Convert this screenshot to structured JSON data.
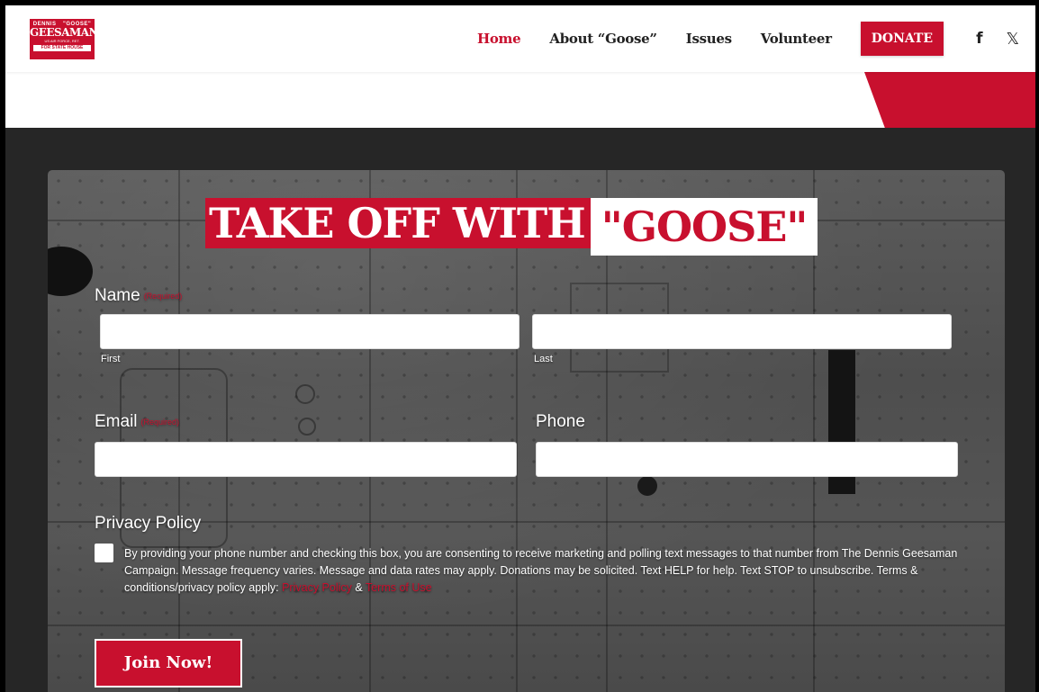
{
  "logo": {
    "line1a": "DENNIS",
    "line1b": "\"GOOSE\"",
    "name": "GEESAMAN",
    "tagline": "US AIR FORCE, RET.",
    "office": "FOR STATE HOUSE"
  },
  "nav": {
    "items": [
      {
        "label": "Home",
        "active": true
      },
      {
        "label": "About “Goose”",
        "active": false
      },
      {
        "label": "Issues",
        "active": false
      },
      {
        "label": "Volunteer",
        "active": false
      }
    ],
    "donate_label": "DONATE",
    "facebook_glyph": "f",
    "x_glyph": "𝕏"
  },
  "colors": {
    "brand_red": "#c8102e",
    "dark_bg": "#262626"
  },
  "headline": {
    "part1": "TAKE OFF WITH",
    "part2": "\"GOOSE\""
  },
  "form": {
    "name_label": "Name",
    "required_text": "(Required)",
    "first_sublabel": "First",
    "last_sublabel": "Last",
    "first_value": "",
    "last_value": "",
    "email_label": "Email",
    "email_value": "",
    "phone_label": "Phone",
    "phone_value": "",
    "privacy_label": "Privacy Policy",
    "privacy_checked": false,
    "consent_text": "By providing your phone number and checking this box, you are consenting to receive marketing and polling text messages to that number from The Dennis Geesaman Campaign. Message frequency varies. Message and data rates may apply. Donations may be solicited. Text HELP for help. Text STOP to unsubscribe. Terms & conditions/privacy policy apply: ",
    "privacy_link": "Privacy Policy",
    "amp": " & ",
    "terms_link": "Terms of Use",
    "submit_label": "Join Now!"
  }
}
